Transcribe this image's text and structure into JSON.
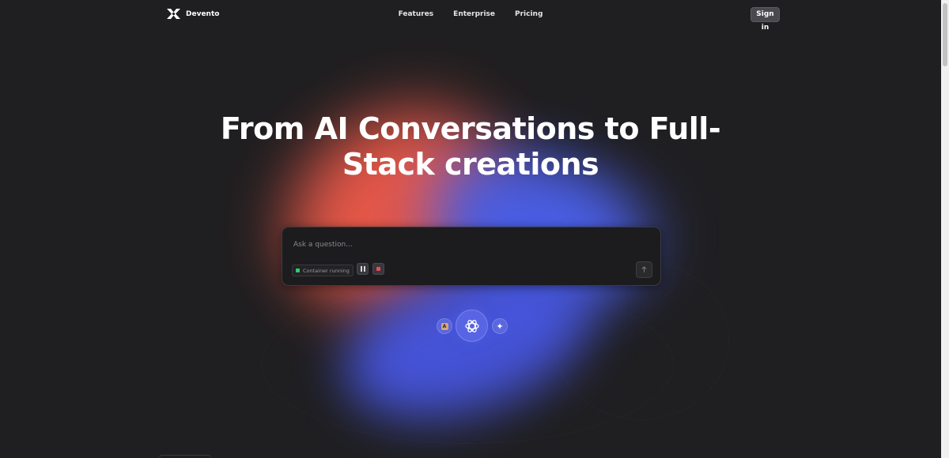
{
  "nav": {
    "brand": "Devento",
    "links": [
      "Features",
      "Enterprise",
      "Pricing"
    ],
    "sign_in": "Sign in"
  },
  "hero": {
    "title_line1": "From AI Conversations to Full-",
    "title_line2": "Stack creations"
  },
  "prompt": {
    "placeholder": "Ask a question...",
    "status": "Container running",
    "send_icon": "arrow-up-icon"
  },
  "models": {
    "left_badge": "A",
    "left_icon": "anthropic-icon",
    "center_icon": "openai-icon",
    "right_icon": "sparkle-icon",
    "right_glyph": "✦"
  },
  "colors": {
    "background": "#1f1e20",
    "glow_red": "#ee5a4a",
    "glow_blue": "#4a5fe8",
    "status_green": "#2ecc71",
    "stop_red": "#ef4b5c"
  }
}
